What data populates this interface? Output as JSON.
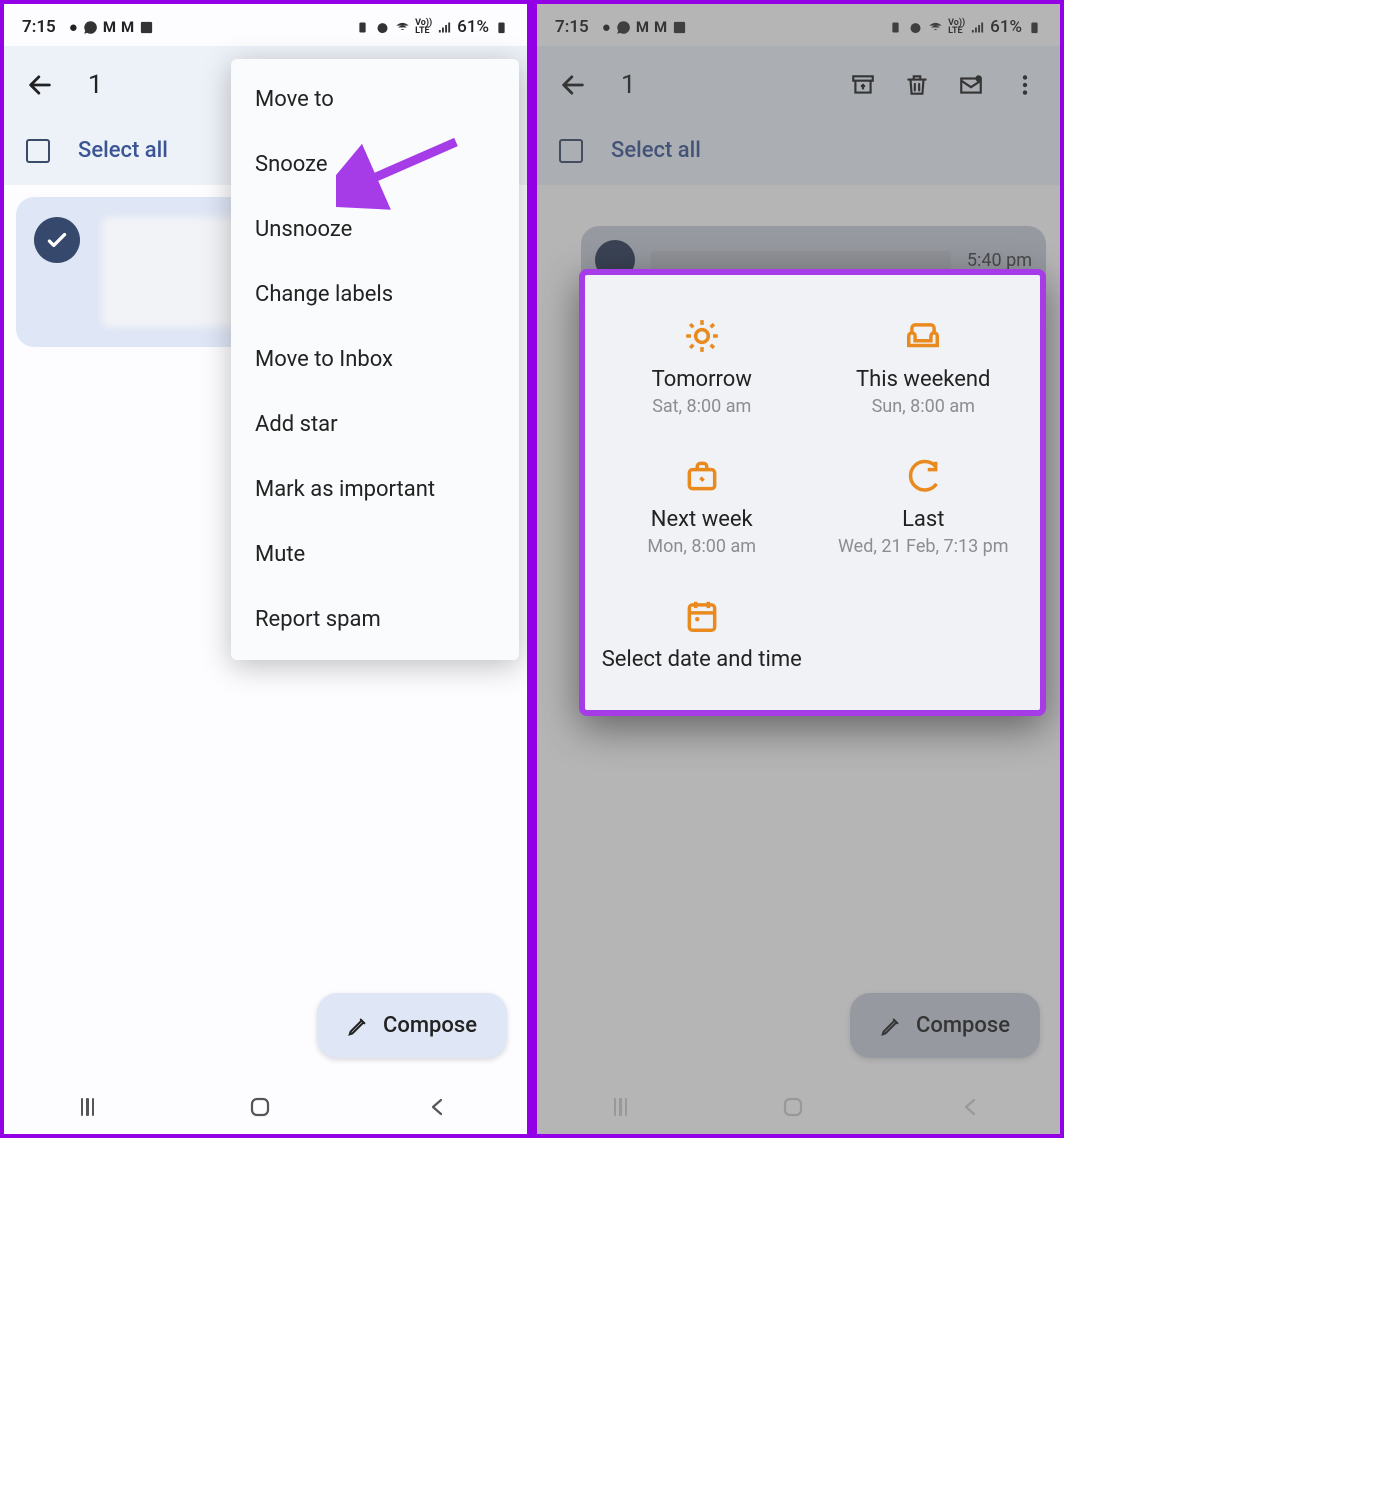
{
  "status": {
    "time": "7:15",
    "battery": "61%"
  },
  "header": {
    "count": "1"
  },
  "select_all": "Select all",
  "overflow": {
    "move_to": "Move to",
    "snooze": "Snooze",
    "unsnooze": "Unsnooze",
    "change_labels": "Change labels",
    "move_inbox": "Move to Inbox",
    "add_star": "Add star",
    "mark_important": "Mark as important",
    "mute": "Mute",
    "report_spam": "Report spam"
  },
  "compose": "Compose",
  "email": {
    "time": "5:40 pm"
  },
  "snooze": {
    "tomorrow": {
      "title": "Tomorrow",
      "sub": "Sat, 8:00 am"
    },
    "weekend": {
      "title": "This weekend",
      "sub": "Sun, 8:00 am"
    },
    "nextweek": {
      "title": "Next week",
      "sub": "Mon, 8:00 am"
    },
    "last": {
      "title": "Last",
      "sub": "Wed, 21 Feb, 7:13 pm"
    },
    "select": {
      "title": "Select date and time"
    }
  }
}
